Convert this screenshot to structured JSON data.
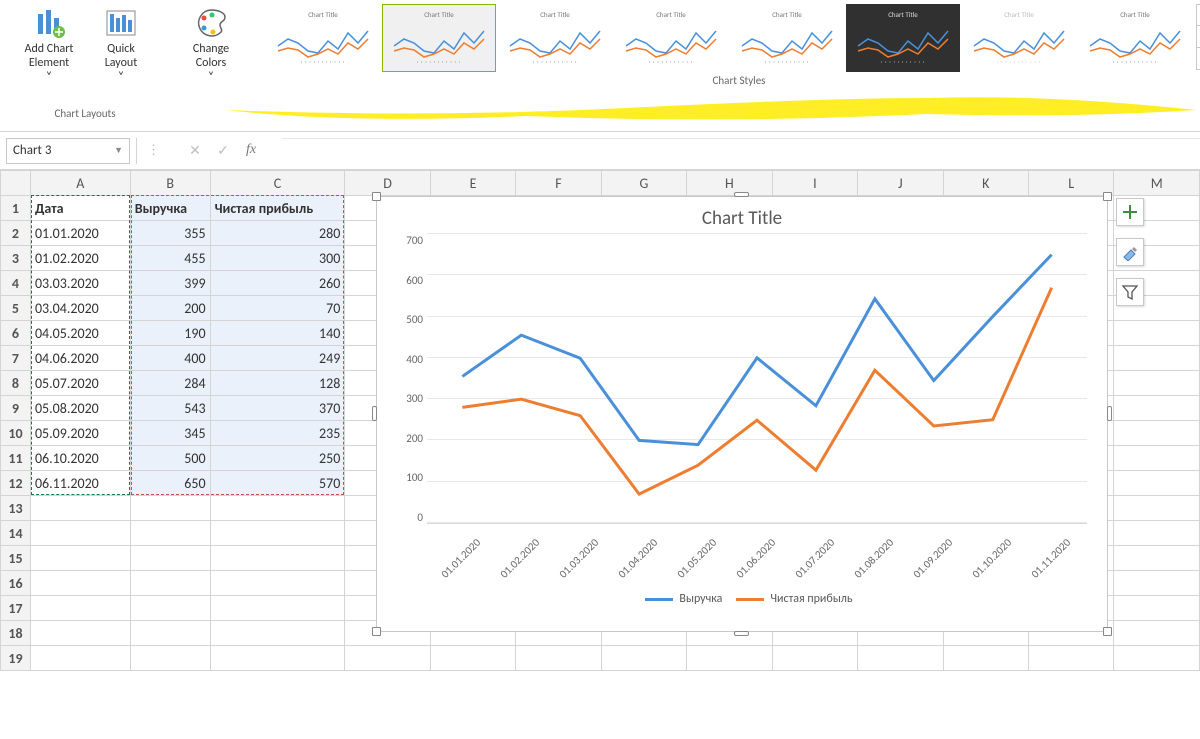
{
  "ribbon": {
    "add_chart_element": "Add Chart\nElement",
    "quick_layout": "Quick\nLayout",
    "change_colors": "Change\nColors",
    "group_layouts": "Chart Layouts",
    "group_styles": "Chart Styles",
    "style_thumb_title": "Chart Title"
  },
  "name_box": "Chart 3",
  "columns": [
    "A",
    "B",
    "C",
    "D",
    "E",
    "F",
    "G",
    "H",
    "I",
    "J",
    "K",
    "L",
    "M"
  ],
  "rows": [
    1,
    2,
    3,
    4,
    5,
    6,
    7,
    8,
    9,
    10,
    11,
    12,
    13,
    14,
    15,
    16,
    17,
    18,
    19
  ],
  "headers": {
    "date": "Дата",
    "revenue": "Выручка",
    "profit": "Чистая прибыль"
  },
  "data": [
    {
      "date": "01.01.2020",
      "rev": 355,
      "prof": 280
    },
    {
      "date": "01.02.2020",
      "rev": 455,
      "prof": 300
    },
    {
      "date": "03.03.2020",
      "rev": 399,
      "prof": 260
    },
    {
      "date": "03.04.2020",
      "rev": 200,
      "prof": 70
    },
    {
      "date": "04.05.2020",
      "rev": 190,
      "prof": 140
    },
    {
      "date": "04.06.2020",
      "rev": 400,
      "prof": 249
    },
    {
      "date": "05.07.2020",
      "rev": 284,
      "prof": 128
    },
    {
      "date": "05.08.2020",
      "rev": 543,
      "prof": 370
    },
    {
      "date": "05.09.2020",
      "rev": 345,
      "prof": 235
    },
    {
      "date": "06.10.2020",
      "rev": 500,
      "prof": 250
    },
    {
      "date": "06.11.2020",
      "rev": 650,
      "prof": 570
    }
  ],
  "chart_data": {
    "type": "line",
    "title": "Chart Title",
    "categories": [
      "01.01.2020",
      "01.02.2020",
      "01.03.2020",
      "01.04.2020",
      "01.05.2020",
      "01.06.2020",
      "01.07.2020",
      "01.08.2020",
      "01.09.2020",
      "01.10.2020",
      "01.11.2020"
    ],
    "series": [
      {
        "name": "Выручка",
        "color": "#4a90d9",
        "values": [
          355,
          455,
          399,
          200,
          190,
          400,
          284,
          543,
          345,
          500,
          650
        ]
      },
      {
        "name": "Чистая прибыль",
        "color": "#ed7d31",
        "values": [
          280,
          300,
          260,
          70,
          140,
          249,
          128,
          370,
          235,
          250,
          570
        ]
      }
    ],
    "ylim": [
      0,
      700
    ],
    "ystep": 100,
    "xlabel": "",
    "ylabel": ""
  },
  "side": {
    "plus": "chart-elements",
    "brush": "chart-styles",
    "filter": "chart-filters"
  }
}
